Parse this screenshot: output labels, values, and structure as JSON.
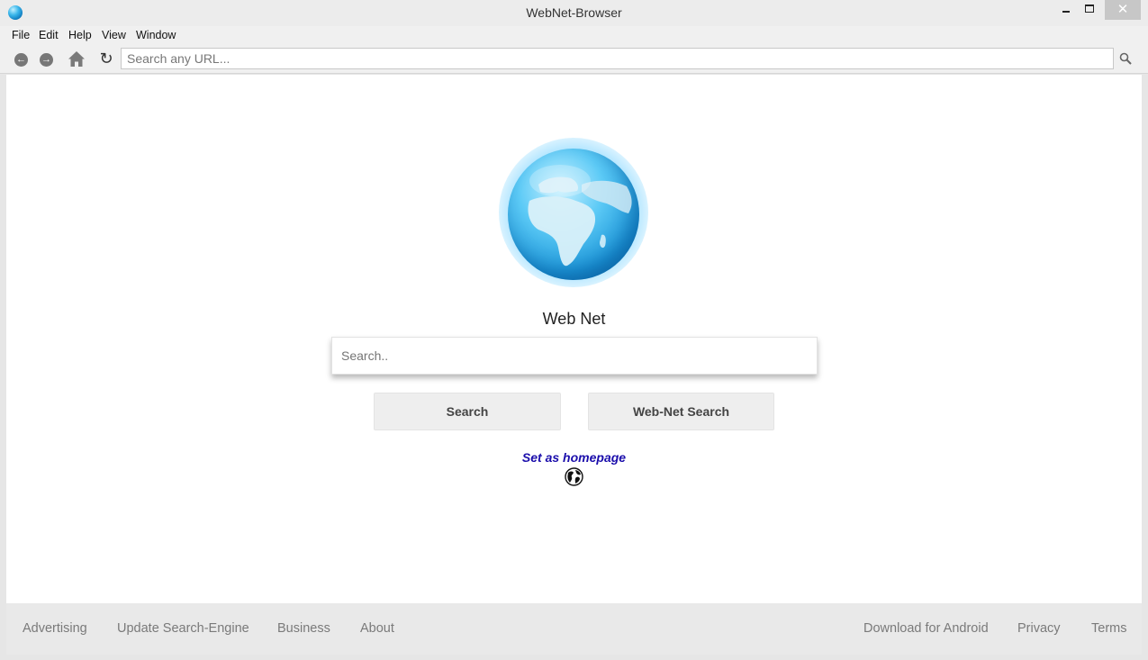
{
  "window": {
    "title": "WebNet-Browser",
    "close_glyph": "✕"
  },
  "menu": [
    "File",
    "Edit",
    "Help",
    "View",
    "Window"
  ],
  "navbar": {
    "back_glyph": "←",
    "forward_glyph": "→",
    "reload_glyph": "↻",
    "url_placeholder": "Search any URL..."
  },
  "main": {
    "brand": "Web Net",
    "search_placeholder": "Search..",
    "search_button": "Search",
    "webnet_search_button": "Web-Net Search",
    "set_homepage": "Set as homepage"
  },
  "footer": {
    "left": [
      "Advertising",
      "Update Search-Engine",
      "Business",
      "About"
    ],
    "right": [
      "Download for Android",
      "Privacy",
      "Terms"
    ]
  },
  "colors": {
    "link": "#1a0dab",
    "globe": "#1b95d8",
    "footer_bg": "#e9e9e9"
  }
}
